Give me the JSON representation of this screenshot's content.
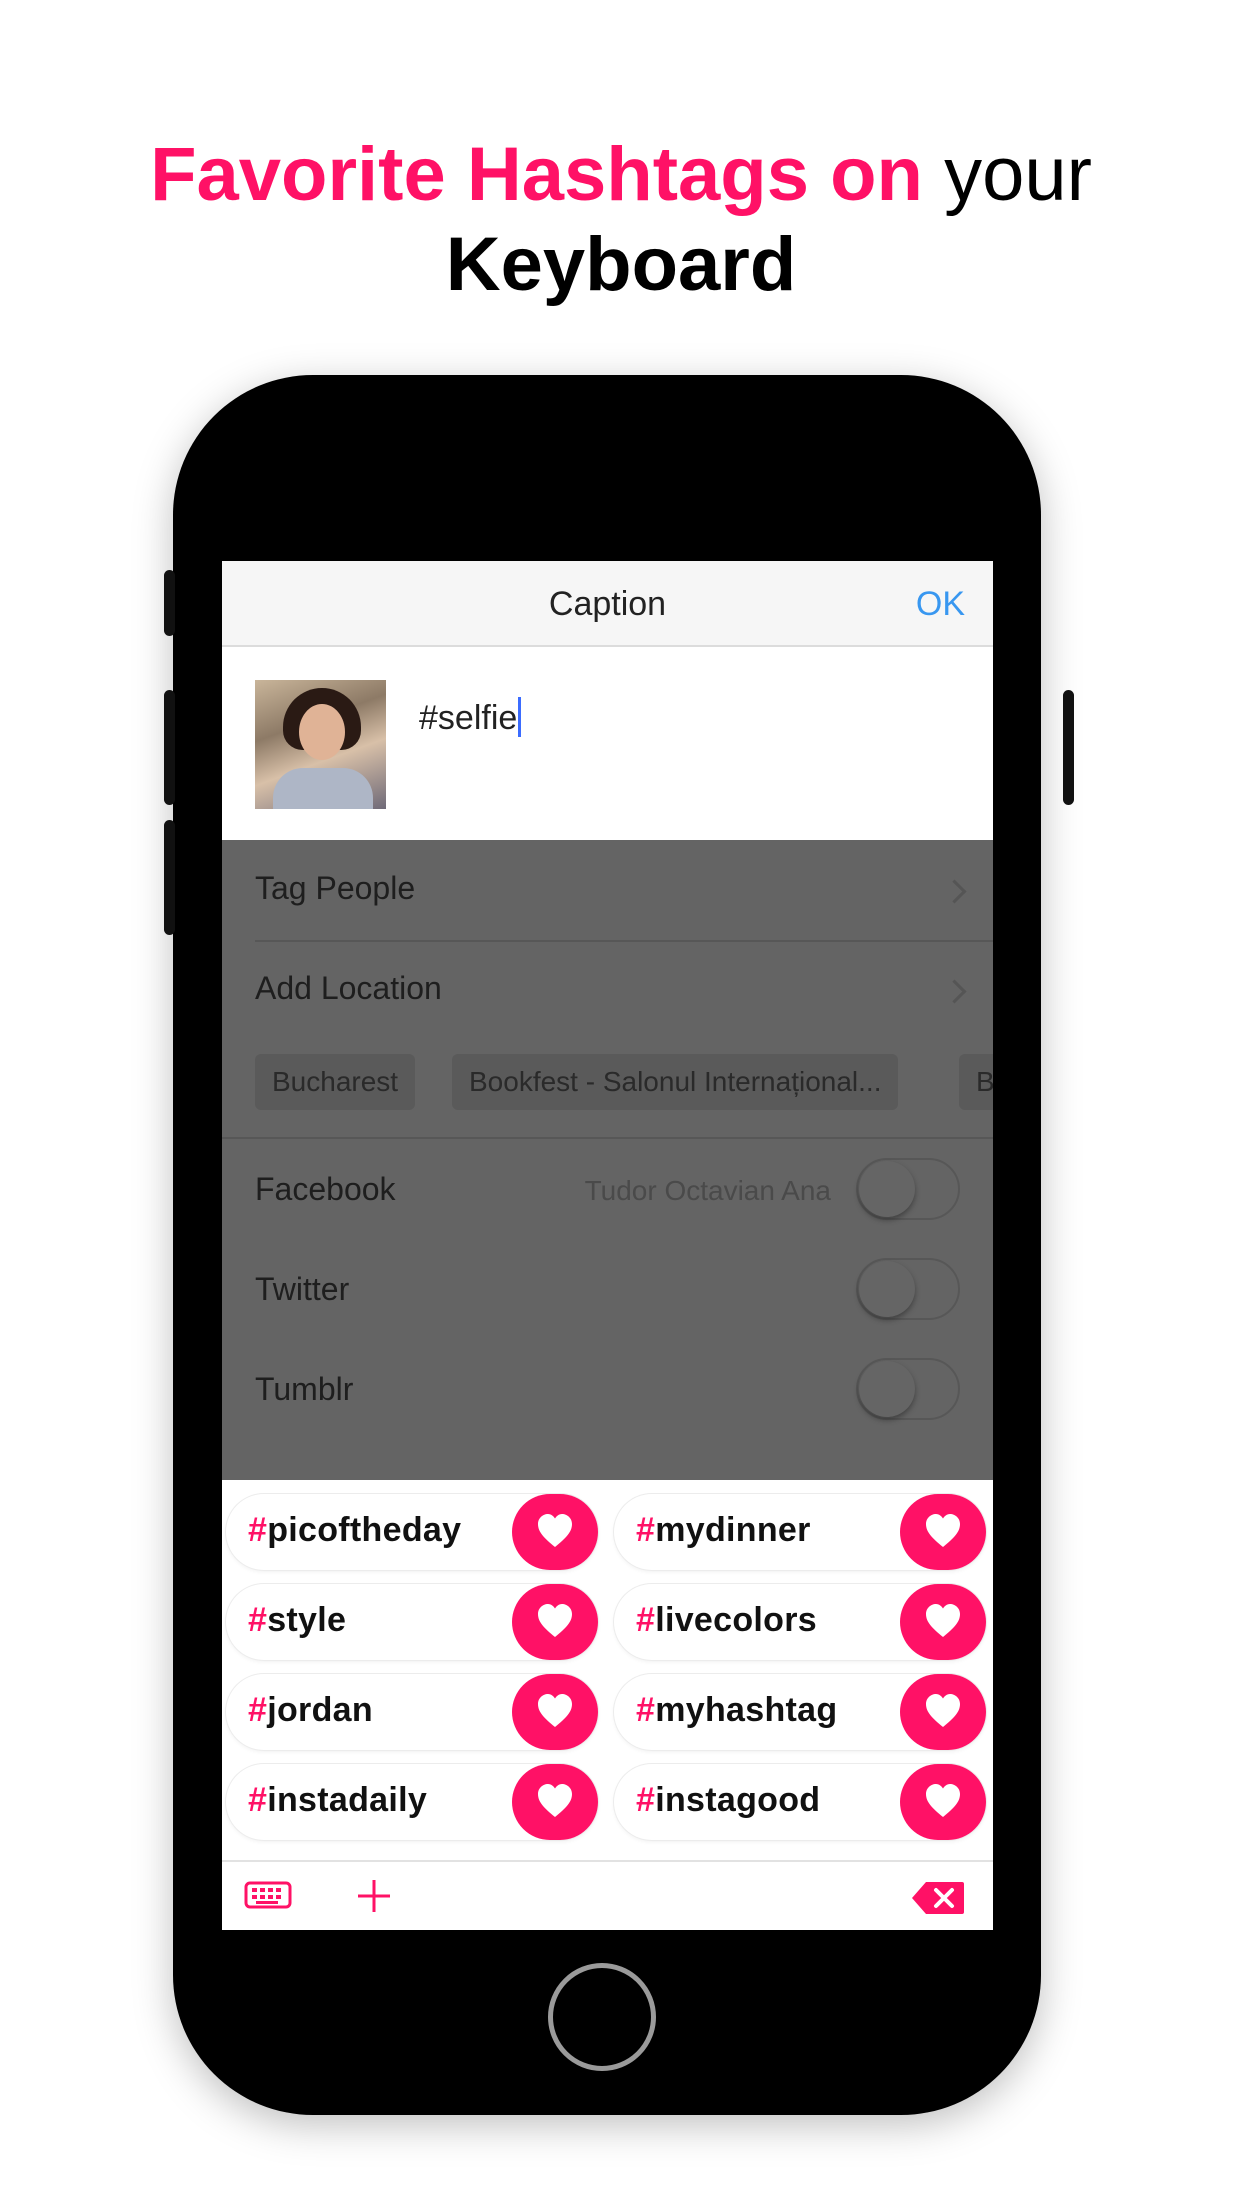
{
  "headline": {
    "pink_text": "Favorite Hashtags on",
    "plain_text": "your",
    "bold_text": "Keyboard"
  },
  "colors": {
    "accent": "#ff1166",
    "link": "#3897f0"
  },
  "nav": {
    "title": "Caption",
    "ok_label": "OK"
  },
  "caption": {
    "text": "#selfie"
  },
  "settings": {
    "tag_people": "Tag People",
    "add_location": "Add Location",
    "location_chips": [
      "Bucharest",
      "Bookfest - Salonul Internațional...",
      "Bu"
    ],
    "share": [
      {
        "label": "Facebook",
        "value": "Tudor Octavian Ana",
        "on": false
      },
      {
        "label": "Twitter",
        "value": "",
        "on": false
      },
      {
        "label": "Tumblr",
        "value": "",
        "on": false
      }
    ]
  },
  "keyboard": {
    "hashtags": [
      {
        "tag": "picoftheday"
      },
      {
        "tag": "mydinner"
      },
      {
        "tag": "style"
      },
      {
        "tag": "livecolors"
      },
      {
        "tag": "jordan"
      },
      {
        "tag": "myhashtag"
      },
      {
        "tag": "instadaily"
      },
      {
        "tag": "instagood"
      }
    ],
    "hash_symbol": "#",
    "toolbar_icons": [
      "keyboard-icon",
      "plus-icon",
      "backspace-icon"
    ]
  }
}
